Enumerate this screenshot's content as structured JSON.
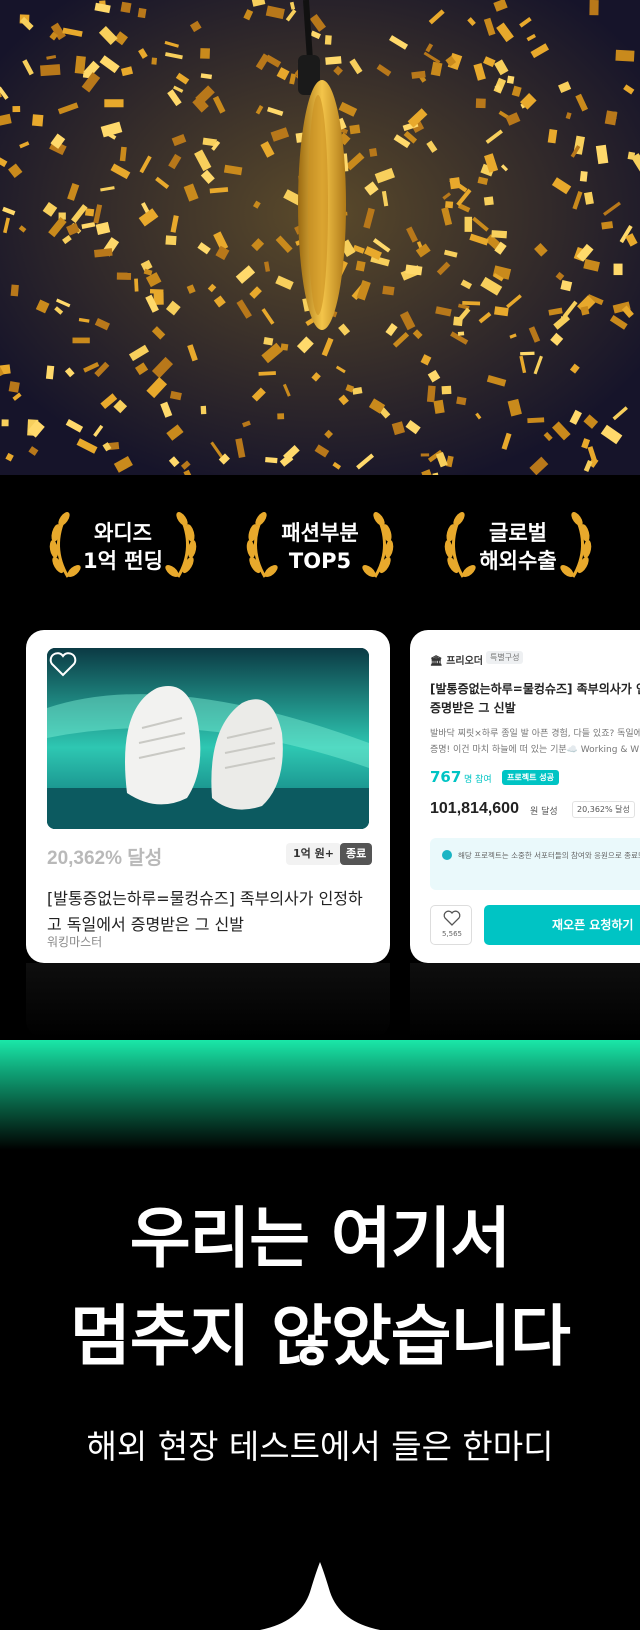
{
  "awards": [
    {
      "line1": "와디즈",
      "line2": "1억 펀딩"
    },
    {
      "line1": "패션부분",
      "line2": "TOP5"
    },
    {
      "line1": "글로벌",
      "line2": "해외수출"
    }
  ],
  "card_main": {
    "percent": "20,362% 달성",
    "tag_amount": "1억 원+",
    "tag_status": "종료",
    "title": "[발통증없는하루=물컹슈즈] 족부의사가 인정하고 독일에서 증명받은 그 신발",
    "maker": "워킹마스터"
  },
  "card_detail": {
    "brand": "프리오더",
    "brand_badge": "특별구성",
    "title_line1": "[발통증없는하루=물컹슈즈] 족부의사가 인",
    "title_line2": "증명받은 그 신발",
    "desc_line1": "발바닥 찌릿×하루 종일 발 아픈 경험, 다들 있죠? 독일에",
    "desc_line2": "증명! 이건 마치 하늘에 떠 있는 기분☁️ Working & W",
    "people": "767",
    "people_unit": "명 참여",
    "success_badge": "프로젝트 성공",
    "amount": "101,814,600",
    "amount_unit": "원 달성",
    "amount_percent": "20,362% 달성",
    "notice": "해당 프로젝트는 소중한 서포터들의 참여와 응원으로 종료되었습니다.",
    "like_count": "5,565",
    "reopen_label": "재오픈 요청하기"
  },
  "headline_line1": "우리는 여기서",
  "headline_line2": "멈추지 않았습니다",
  "subline": "해외 현장 테스트에서 들은 한마디",
  "colors": {
    "accent": "#00c4c4",
    "gold": "#e8a92c",
    "band": "#1ae7a8"
  }
}
